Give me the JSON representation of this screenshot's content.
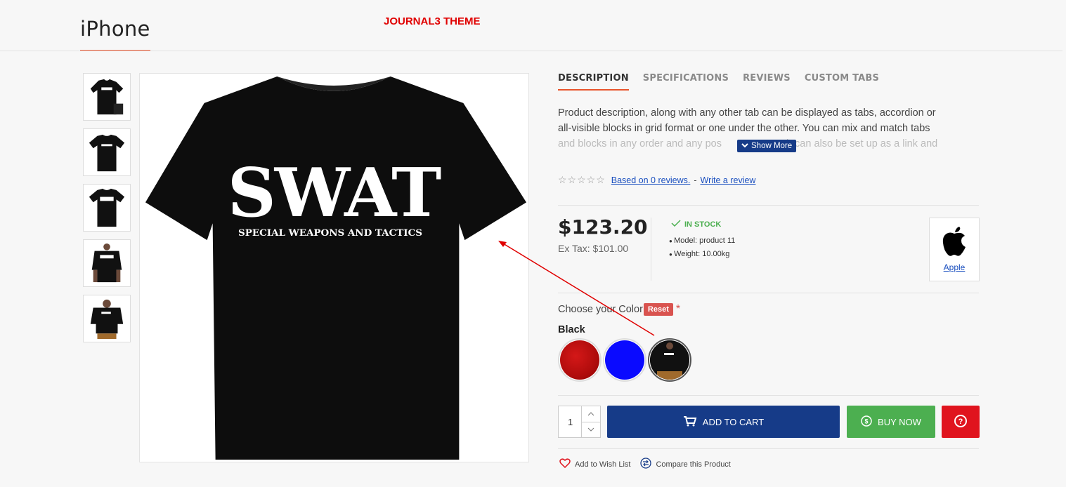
{
  "page": {
    "title": "iPhone",
    "theme_label": "JOURNAL3 THEME"
  },
  "tabs": [
    {
      "label": "DESCRIPTION",
      "active": true
    },
    {
      "label": "SPECIFICATIONS",
      "active": false
    },
    {
      "label": "REVIEWS",
      "active": false
    },
    {
      "label": "CUSTOM TABS",
      "active": false
    }
  ],
  "description": {
    "line1": "Product description, along with any other tab can be displayed as tabs, accordion or",
    "line2": "all-visible blocks in grid format or one under the other.  You can mix and match tabs",
    "line3a": "and blocks in any order and any pos",
    "line3b": "h can also be set up as a link and",
    "show_more": "Show More"
  },
  "rating": {
    "stars": "☆☆☆☆☆",
    "reviews_link": "Based on 0 reviews.",
    "separator": "-",
    "write_link": "Write a review"
  },
  "price": {
    "amount": "$123.20",
    "ex_tax": "Ex Tax: $101.00"
  },
  "stock": {
    "status": "IN STOCK",
    "model": "Model: product 11",
    "weight": "Weight: 10.00kg"
  },
  "brand": {
    "name": "Apple"
  },
  "option": {
    "label": "Choose your Color",
    "reset": "Reset",
    "required": "*",
    "selected": "Black",
    "swatches": [
      {
        "name": "red",
        "color": "#c40f0f"
      },
      {
        "name": "blue",
        "color": "#0a0aff"
      },
      {
        "name": "black",
        "color": "#111111"
      }
    ]
  },
  "cart": {
    "quantity": "1",
    "add_to_cart": "ADD TO CART",
    "buy_now": "BUY NOW"
  },
  "links": {
    "wishlist": "Add to Wish List",
    "compare": "Compare this Product"
  },
  "colors": {
    "accent": "#e8542c",
    "primary_blue": "#163b88",
    "buy_green": "#4caf50",
    "question_red": "#e0141e",
    "reset_red": "#d9534f"
  },
  "product_image_text": {
    "headline": "SWAT",
    "subline": "SPECIAL WEAPONS AND TACTICS"
  }
}
